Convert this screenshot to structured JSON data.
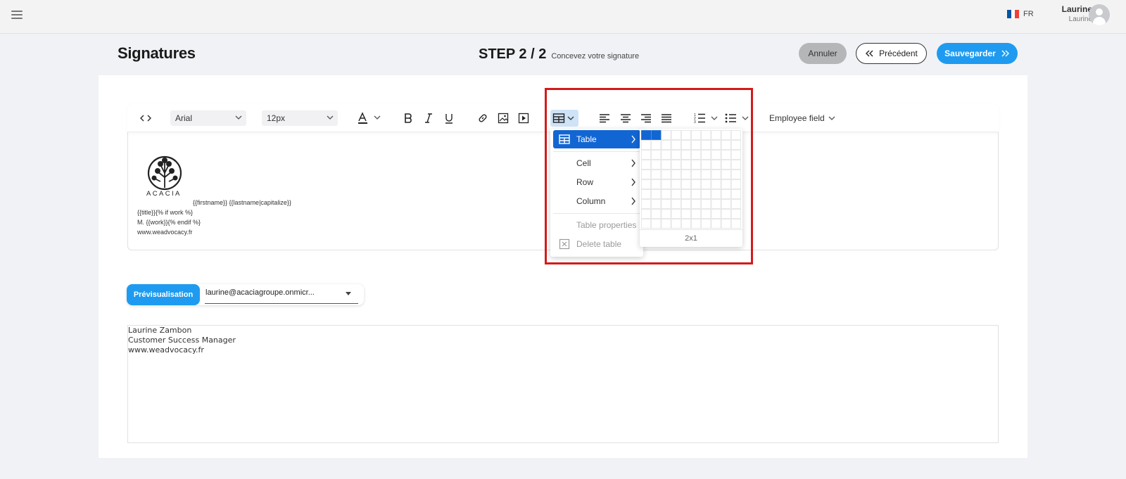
{
  "topbar": {
    "menu_icon": "hamburger-icon",
    "lang": "FR",
    "flag_colors": [
      "#0055a4",
      "#ffffff",
      "#ef4135"
    ],
    "user_name": "Laurine",
    "user_sub": "Laurine"
  },
  "header": {
    "title": "Signatures",
    "step": "STEP 2 / 2",
    "step_desc": "Concevez votre signature",
    "cancel_label": "Annuler",
    "prev_label": "Précédent",
    "save_label": "Sauvegarder"
  },
  "colors": {
    "accent": "#1e9bf0",
    "menu_active": "#1266d3",
    "highlight": "#d41a1a"
  },
  "toolbar": {
    "font_family": "Arial",
    "font_size": "12px",
    "employee_field": "Employee field"
  },
  "editor": {
    "logo_text": "ACACIA",
    "line1": "{{firstname}} {{lastname|capitalize}}",
    "line2": "{{title}}{% if work %}",
    "line3": "M. {{work}}{% endif %}",
    "line4": "www.weadvocacy.fr"
  },
  "table_menu": {
    "items": [
      {
        "label": "Table"
      },
      {
        "label": "Cell"
      },
      {
        "label": "Row"
      },
      {
        "label": "Column"
      },
      {
        "label": "Table properties"
      },
      {
        "label": "Delete table"
      }
    ],
    "grid_label": "2x1",
    "grid_selected_cols": 2,
    "grid_selected_rows": 1
  },
  "preview": {
    "button_label": "Prévisualisation",
    "email_value": "laurine@acaciagroupe.onmicr...",
    "lines": [
      "Laurine Zambon",
      "Customer Success Manager",
      "www.weadvocacy.fr"
    ]
  }
}
